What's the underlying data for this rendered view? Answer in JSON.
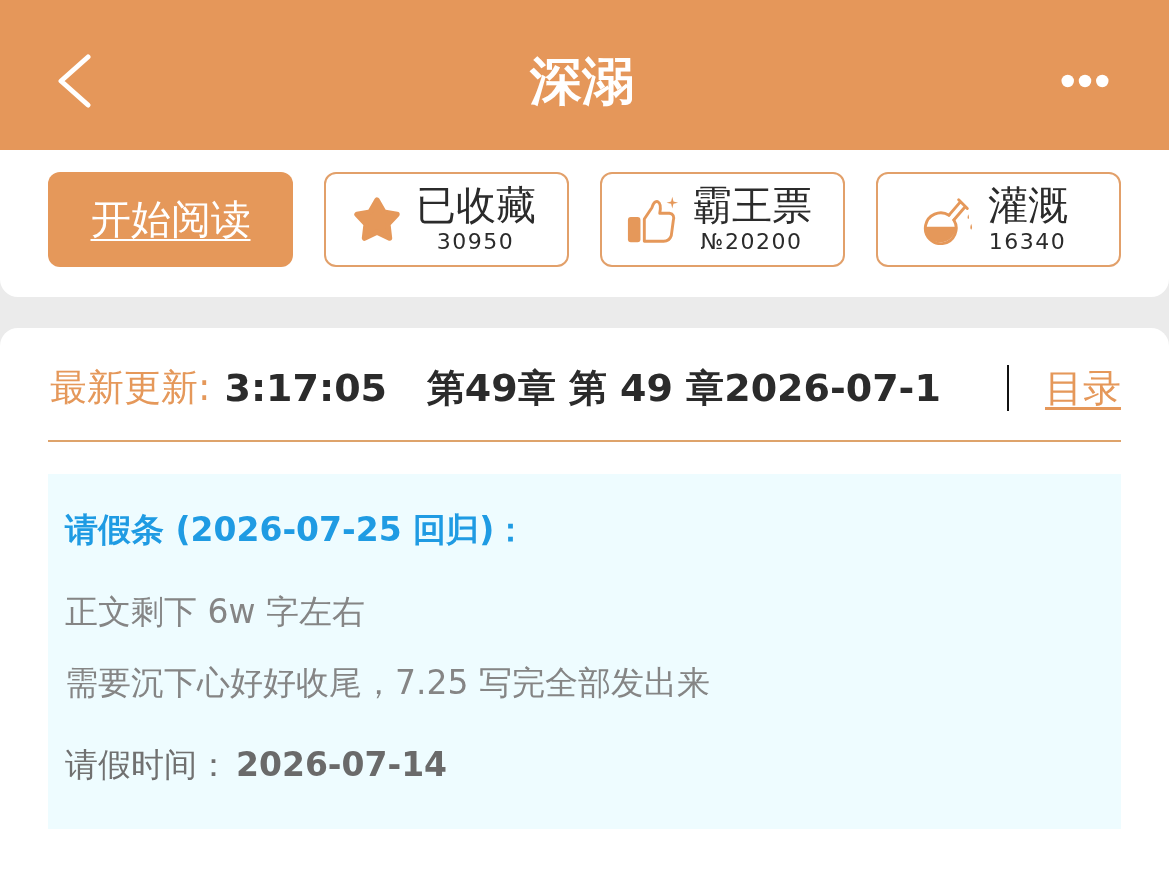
{
  "header": {
    "title": "深溺"
  },
  "actions": [
    {
      "kind": "read",
      "label": "开始阅读"
    },
    {
      "kind": "stat",
      "label": "已收藏",
      "count": "30950"
    },
    {
      "kind": "stat",
      "label": "霸王票",
      "count": "№20200"
    },
    {
      "kind": "stat",
      "label": "灌溉",
      "count": "16340"
    }
  ],
  "update": {
    "label": "最新更新:",
    "ticker": "3:17:05   第49章 第 49 章2026-07-1",
    "link": "目录"
  },
  "notice": {
    "title": "请假条 (2026-07-25 回归)：",
    "lines": [
      "正文剩下 6w 字左右",
      "需要沉下心好好收尾，7.25 写完全部发出来"
    ],
    "date_label": "请假时间：",
    "date": "2026-07-14"
  }
}
